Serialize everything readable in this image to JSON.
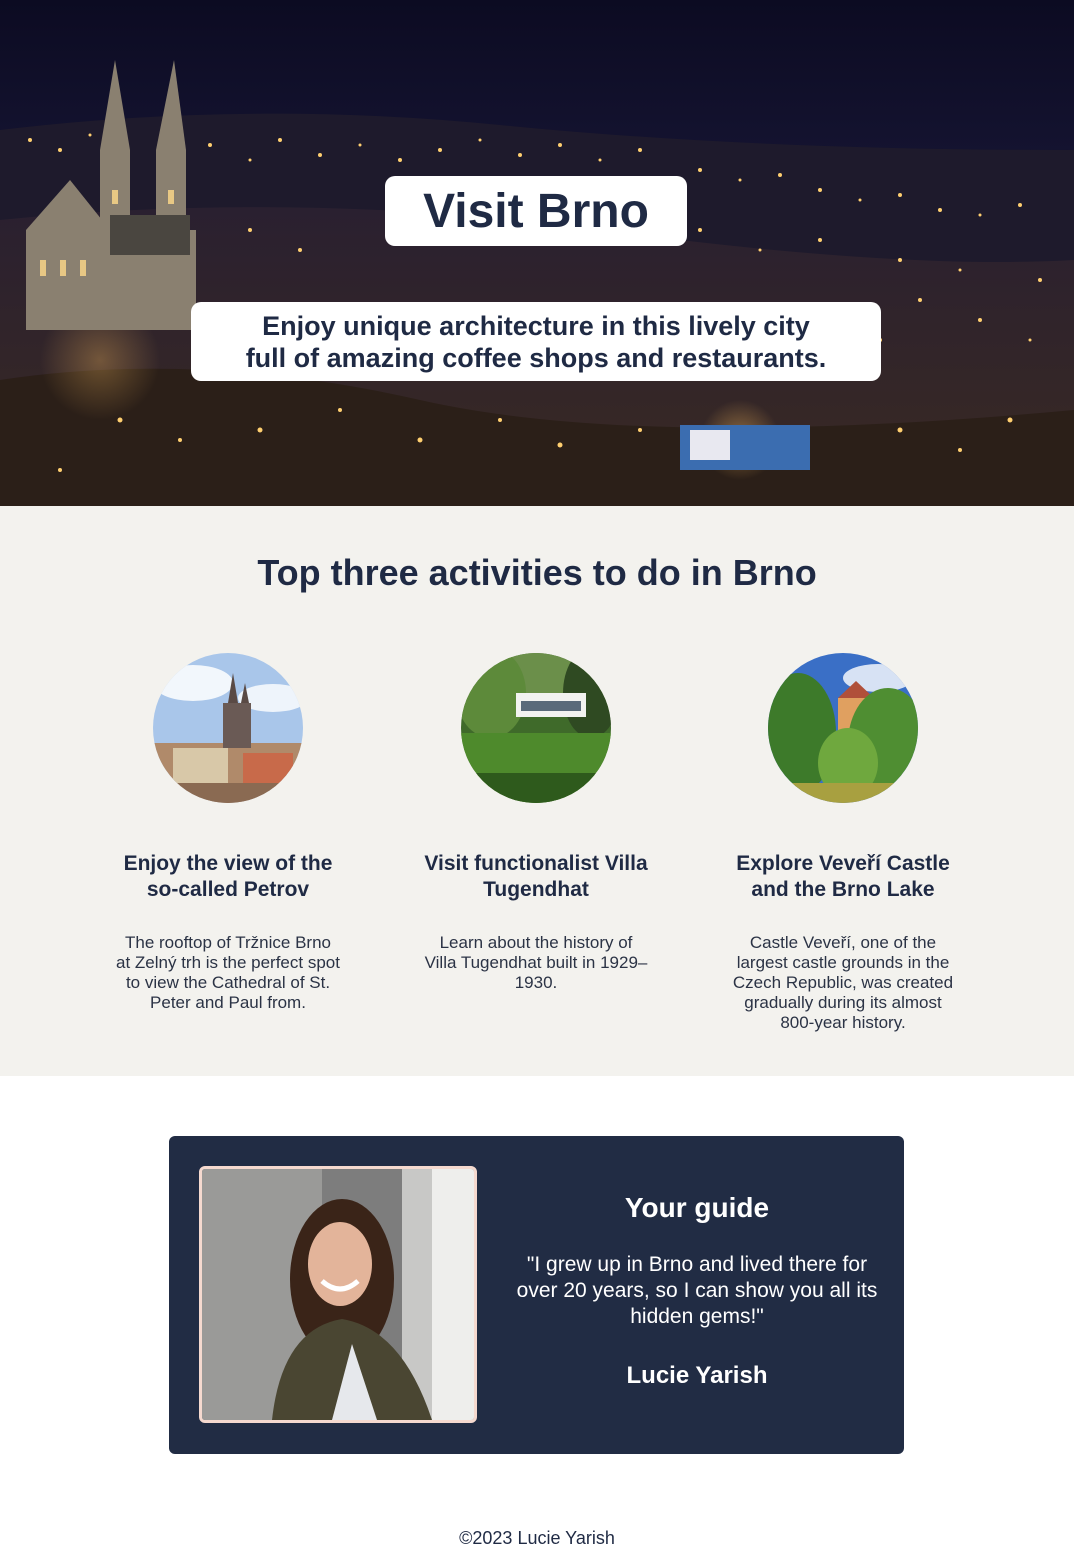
{
  "hero": {
    "title": "Visit Brno",
    "subtitle": "Enjoy unique architecture in this lively city full of amazing coffee shops and restaurants."
  },
  "activities": {
    "heading": "Top three activities to do in Brno",
    "items": [
      {
        "title": "Enjoy the view of the so-called Petrov",
        "description": "The rooftop of Tržnice Brno at Zelný trh is the perfect spot to view the Cathedral of St. Peter and Paul from."
      },
      {
        "title": "Visit functionalist Villa Tugendhat",
        "description": "Learn about the history of Villa Tugendhat built in 1929–1930."
      },
      {
        "title": "Explore Veveří Castle and the Brno Lake",
        "description": "Castle Veveří, one of the largest castle grounds in the Czech Republic, was created gradually during its almost 800-year history."
      }
    ]
  },
  "guide": {
    "title": "Your guide",
    "quote": "\"I grew up in Brno and lived there for over 20 years, so I can show you all its hidden gems!\"",
    "name": "Lucie Yarish"
  },
  "footer": {
    "copyright": "©2023 Lucie Yarish"
  },
  "colors": {
    "navy": "#1f2a44",
    "guide_bg": "#212c44",
    "section_bg": "#f3f2ee",
    "photo_border": "#f5d9cf"
  }
}
